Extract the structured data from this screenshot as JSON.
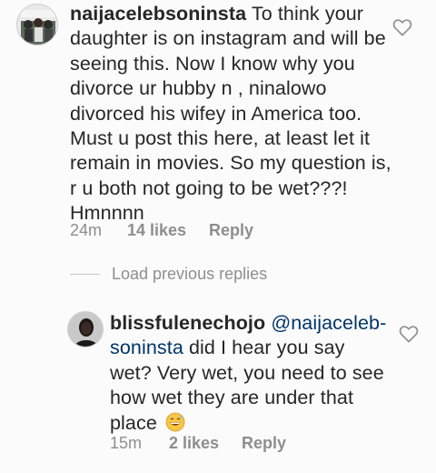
{
  "comments": [
    {
      "username": "naijacelebsoninsta",
      "text": "To think your daughter is on instagram and will be seeing this. Now I know why you divorce ur hubby n , ninalowo divorced his wifey in America too. Must u post this here, at least let it remain in movies. So my question is, r u both not going to be wet???! Hmnnnn",
      "time": "24m",
      "likes": "14 likes",
      "reply_label": "Reply"
    }
  ],
  "load_previous": "Load previous replies",
  "reply": {
    "username": "blissfulenechojo",
    "mention": "@naijaceleb-soninsta",
    "text": "did I hear you say wet? Very wet, you need to see how wet they are under that place",
    "emoji": "grinning-sweat-emoji",
    "time": "15m",
    "likes": "2 likes",
    "reply_label": "Reply"
  },
  "icons": {
    "like": "heart-outline-icon",
    "heart_color": "#8e8e8e"
  }
}
